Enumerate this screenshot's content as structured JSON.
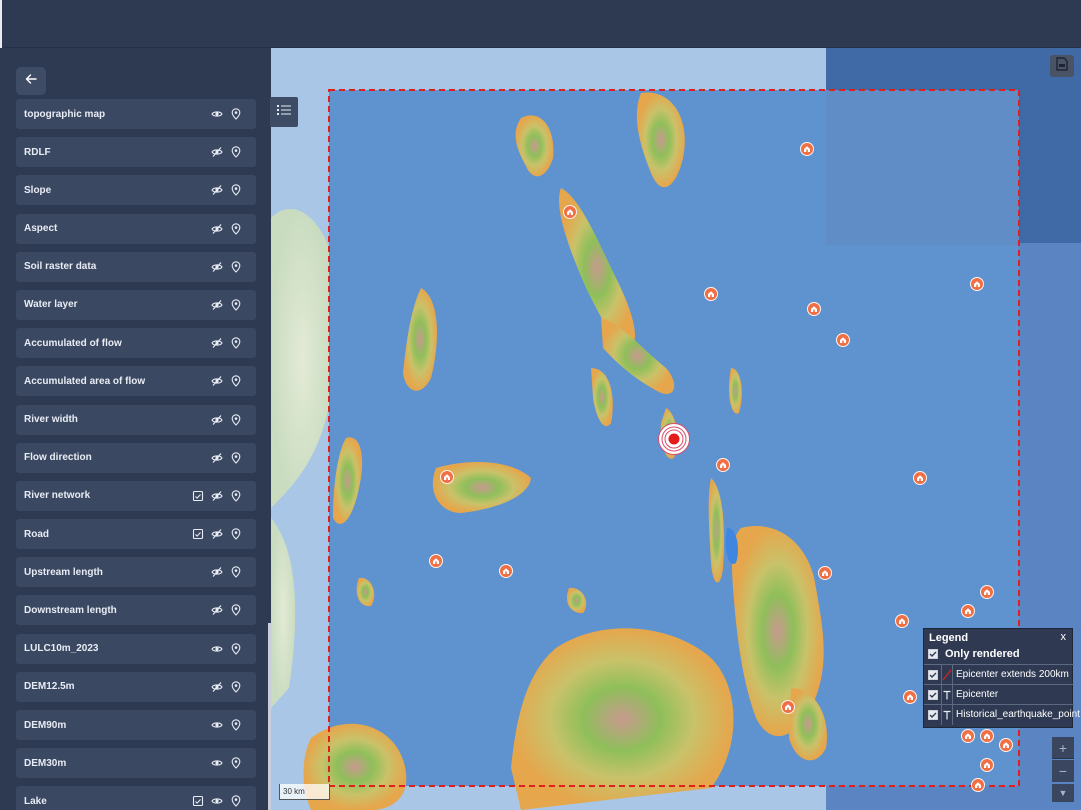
{
  "sidebar": {
    "back_icon": "arrow-left-icon",
    "layers": [
      {
        "label": "topographic map",
        "visible": true,
        "has_table": false
      },
      {
        "label": "RDLF",
        "visible": false,
        "has_table": false
      },
      {
        "label": "Slope",
        "visible": false,
        "has_table": false
      },
      {
        "label": "Aspect",
        "visible": false,
        "has_table": false
      },
      {
        "label": "Soil raster data",
        "visible": false,
        "has_table": false
      },
      {
        "label": "Water layer",
        "visible": false,
        "has_table": false
      },
      {
        "label": "Accumulated of flow",
        "visible": false,
        "has_table": false
      },
      {
        "label": "Accumulated area of flow",
        "visible": false,
        "has_table": false
      },
      {
        "label": "River width",
        "visible": false,
        "has_table": false
      },
      {
        "label": "Flow direction",
        "visible": false,
        "has_table": false
      },
      {
        "label": "River network",
        "visible": false,
        "has_table": true
      },
      {
        "label": "Road",
        "visible": false,
        "has_table": true
      },
      {
        "label": "Upstream length",
        "visible": false,
        "has_table": false
      },
      {
        "label": "Downstream length",
        "visible": false,
        "has_table": false
      },
      {
        "label": "LULC10m_2023",
        "visible": true,
        "has_table": false
      },
      {
        "label": "DEM12.5m",
        "visible": false,
        "has_table": false
      },
      {
        "label": "DEM90m",
        "visible": true,
        "has_table": false
      },
      {
        "label": "DEM30m",
        "visible": true,
        "has_table": false
      },
      {
        "label": "Lake",
        "visible": true,
        "has_table": true
      }
    ]
  },
  "map": {
    "scale_label": "30 km",
    "zoom_in": "+",
    "zoom_out": "−",
    "scroll_down": "▼",
    "colors": {
      "sea": "#6b9fd6",
      "extent_line": "#e0201c",
      "marker": "#f06f45",
      "epicenter": "#e51c1c"
    }
  },
  "legend": {
    "title": "Legend",
    "close": "x",
    "only_rendered": "Only rendered",
    "entries": [
      {
        "label": "Epicenter extends 200km",
        "checked": true
      },
      {
        "label": "Epicenter",
        "checked": true
      },
      {
        "label": "Historical_earthquake_point",
        "checked": true
      }
    ]
  }
}
